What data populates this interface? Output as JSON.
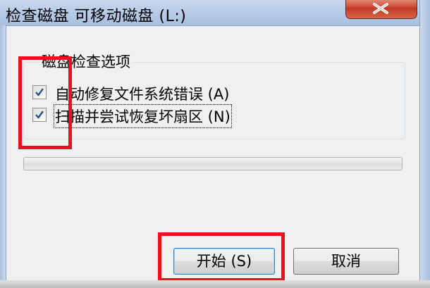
{
  "window": {
    "title": "检查磁盘 可移动磁盘 (L:)",
    "close_icon": "close-icon"
  },
  "options_group": {
    "legend": "磁盘检查选项",
    "options": [
      {
        "label": "自动修复文件系统错误 (A)",
        "checked": true
      },
      {
        "label": "扫描并尝试恢复坏扇区 (N)",
        "checked": true
      }
    ]
  },
  "progress": {
    "value": 0
  },
  "buttons": {
    "start": "开始 (S)",
    "cancel": "取消"
  },
  "colors": {
    "highlight_box": "#e8111d",
    "progress_fill": "#37c33a"
  }
}
